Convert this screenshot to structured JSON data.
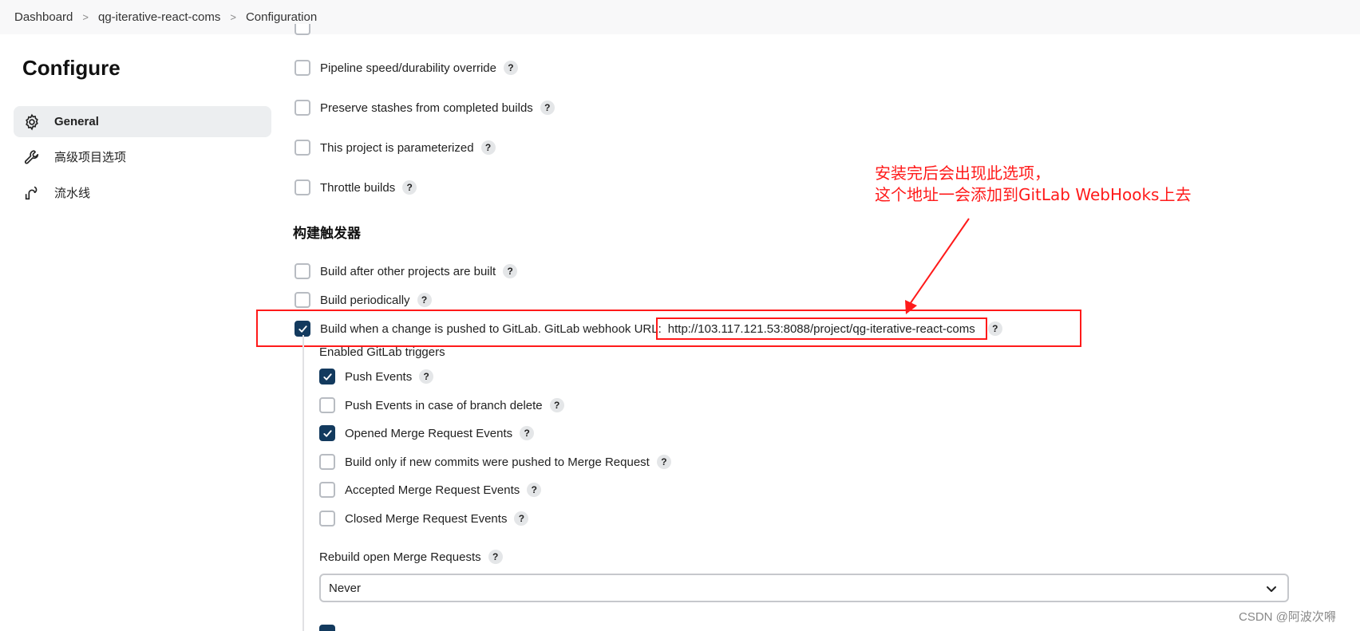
{
  "breadcrumb": {
    "items": [
      "Dashboard",
      "qg-iterative-react-coms",
      "Configuration"
    ],
    "separator": ">"
  },
  "page": {
    "title": "Configure"
  },
  "sidebar": {
    "items": [
      {
        "label": "General",
        "icon": "gear-icon",
        "active": true
      },
      {
        "label": "高级项目选项",
        "icon": "wrench-icon",
        "active": false
      },
      {
        "label": "流水线",
        "icon": "pipeline-icon",
        "active": false
      }
    ]
  },
  "general_options": [
    {
      "label": "Pipeline speed/durability override",
      "checked": false
    },
    {
      "label": "Preserve stashes from completed builds",
      "checked": false
    },
    {
      "label": "This project is parameterized",
      "checked": false
    },
    {
      "label": "Throttle builds",
      "checked": false
    }
  ],
  "triggers": {
    "section_title": "构建触发器",
    "items": [
      {
        "label": "Build after other projects are built",
        "checked": false
      },
      {
        "label": "Build periodically",
        "checked": false
      }
    ],
    "gitlab": {
      "label": "Build when a change is pushed to GitLab. GitLab webhook URL:",
      "url": "http://103.117.121.53:8088/project/qg-iterative-react-coms",
      "checked": true
    },
    "enabled_label": "Enabled GitLab triggers",
    "gitlab_events": [
      {
        "label": "Push Events",
        "checked": true
      },
      {
        "label": "Push Events in case of branch delete",
        "checked": false
      },
      {
        "label": "Opened Merge Request Events",
        "checked": true
      },
      {
        "label": "Build only if new commits were pushed to Merge Request",
        "checked": false
      },
      {
        "label": "Accepted Merge Request Events",
        "checked": false
      },
      {
        "label": "Closed Merge Request Events",
        "checked": false
      }
    ],
    "rebuild": {
      "label": "Rebuild open Merge Requests",
      "value": "Never"
    }
  },
  "help_label": "?",
  "annotation": {
    "line1": "安装完后会出现此选项，",
    "line2": "这个地址一会添加到GitLab WebHooks上去"
  },
  "watermark": "CSDN @阿波次嘚",
  "colors": {
    "checkbox_checked": "#133a5e",
    "annotation": "#ff1a1a",
    "sidebar_active_bg": "#eceef0"
  }
}
